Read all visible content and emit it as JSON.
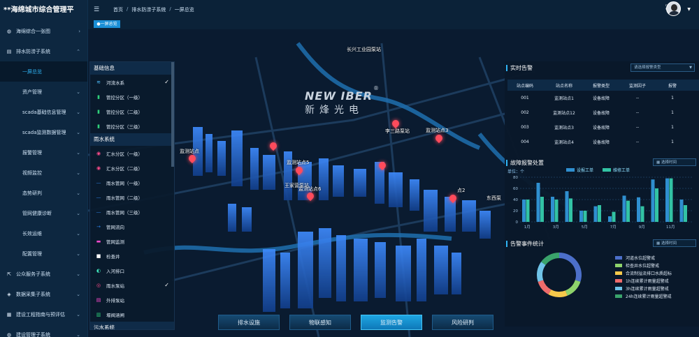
{
  "app": {
    "title": "**海绵城市综合管理平"
  },
  "sidebar": {
    "items": [
      {
        "label": "海绵综合一张图",
        "icon": "globe-icon",
        "chevron": "chevron-right-icon"
      },
      {
        "label": "排水防涝子系统",
        "icon": "drainage-icon",
        "chevron": "chevron-up-icon"
      },
      {
        "label": "一屏总览",
        "active": true
      },
      {
        "label": "资产管理",
        "chevron": "chevron-down-icon"
      },
      {
        "label": "scada基础信息管理",
        "chevron": "chevron-down-icon"
      },
      {
        "label": "scada监测数据管理",
        "chevron": "chevron-down-icon"
      },
      {
        "label": "报警管理",
        "chevron": "chevron-down-icon"
      },
      {
        "label": "视频监控",
        "chevron": "chevron-down-icon"
      },
      {
        "label": "态势研判",
        "chevron": "chevron-down-icon"
      },
      {
        "label": "管网健康诊断",
        "chevron": "chevron-down-icon"
      },
      {
        "label": "长效运维",
        "chevron": "chevron-down-icon"
      },
      {
        "label": "配置管理",
        "chevron": "chevron-down-icon"
      },
      {
        "label": "公众服务子系统",
        "icon": "external-link-icon",
        "chevron": "chevron-down-icon"
      },
      {
        "label": "数据采集子系统",
        "icon": "database-icon",
        "chevron": "chevron-down-icon"
      },
      {
        "label": "建设工程指南与预评估",
        "icon": "document-icon",
        "chevron": "chevron-down-icon"
      },
      {
        "label": "建设管理子系统",
        "icon": "globe-icon",
        "chevron": "chevron-down-icon"
      }
    ]
  },
  "topbar": {
    "breadcrumb": [
      "首页",
      "排水防涝子系统",
      "一屏总览"
    ],
    "separator": "/"
  },
  "tabs": [
    {
      "label": "●一屏总览"
    }
  ],
  "map": {
    "logo_main": "NEW IBER",
    "logo_reg": "®",
    "logo_cn": "新烽光电",
    "labels": [
      "长兴工业园泵站",
      "李三路泵站",
      "监测站点3",
      "监测站点",
      "监测站点5",
      "王家营泵站",
      "监测站点6",
      "点2",
      "东西泵"
    ]
  },
  "layer_panel": {
    "sections": [
      {
        "title": "基础信息",
        "rows": [
          {
            "label": "河流水系",
            "icon": "river-icon",
            "checked": true
          },
          {
            "label": "管控分区（一级）",
            "icon": "zone-icon",
            "checked": false
          },
          {
            "label": "管控分区（二级）",
            "icon": "zone-icon",
            "checked": false
          },
          {
            "label": "管控分区（三级）",
            "icon": "zone-icon",
            "checked": false
          }
        ]
      },
      {
        "title": "雨水系统",
        "rows": [
          {
            "label": "汇水分区（一级）",
            "icon": "catchment-icon",
            "checked": false
          },
          {
            "label": "汇水分区（二级）",
            "icon": "catchment-icon",
            "checked": false
          },
          {
            "label": "雨水管网（一级）",
            "icon": "pipe-icon",
            "checked": false
          },
          {
            "label": "雨水管网（二级）",
            "icon": "pipe-icon",
            "checked": false
          },
          {
            "label": "雨水管网（三级）",
            "icon": "pipe-icon",
            "checked": false
          },
          {
            "label": "管网流向",
            "icon": "flow-icon",
            "checked": false
          },
          {
            "label": "管网监测",
            "icon": "monitor-icon",
            "checked": false
          },
          {
            "label": "检查井",
            "icon": "manhole-icon",
            "checked": false
          },
          {
            "label": "入河排口",
            "icon": "outfall-icon",
            "checked": false
          },
          {
            "label": "雨水泵站",
            "icon": "pump-icon",
            "checked": true
          },
          {
            "label": "外排泵站",
            "icon": "pump-out-icon",
            "checked": false
          },
          {
            "label": "堰阀涵闸",
            "icon": "gate-icon",
            "checked": false
          }
        ]
      },
      {
        "title": "污水系统",
        "rows": []
      }
    ]
  },
  "bottom_tabs": [
    {
      "label": "排水设施",
      "active": false
    },
    {
      "label": "物联感知",
      "active": false
    },
    {
      "label": "监测告警",
      "active": true
    },
    {
      "label": "风险研判",
      "active": false
    }
  ],
  "realtime_alarm": {
    "title": "实时告警",
    "select_placeholder": "请选择报警类型",
    "columns": [
      "站点编码",
      "站点名称",
      "报警类型",
      "监测因子",
      "报警"
    ],
    "rows": [
      [
        "001",
        "监测站点1",
        "设备故障",
        "--",
        "1"
      ],
      [
        "002",
        "监测站点12",
        "设备故障",
        "--",
        "1"
      ],
      [
        "003",
        "监测站点3",
        "设备故障",
        "--",
        "1"
      ],
      [
        "004",
        "监测站点4",
        "设备故障",
        "--",
        "1"
      ]
    ]
  },
  "fault_alarm": {
    "title": "故障报警处置",
    "date_placeholder": "选择时间",
    "unit": "单位：个",
    "legend": [
      "设报工单",
      "维修工单"
    ]
  },
  "alarm_stats": {
    "title": "告警事件统计",
    "date_placeholder": "选择时间"
  },
  "chart_data": [
    {
      "type": "bar",
      "title": "故障报警处置",
      "ylabel": "单位：个",
      "categories": [
        "1月",
        "2月",
        "3月",
        "4月",
        "5月",
        "6月",
        "7月",
        "8月",
        "9月",
        "10月",
        "11月",
        "12月"
      ],
      "x_tick_labels": [
        "1月",
        "3月",
        "5月",
        "7月",
        "9月",
        "11月"
      ],
      "y_ticks": [
        0,
        20,
        40,
        60,
        80
      ],
      "ylim": [
        0,
        80
      ],
      "series": [
        {
          "name": "设报工单",
          "color": "#2f8fd0",
          "values": [
            40,
            70,
            45,
            55,
            20,
            28,
            10,
            47,
            44,
            76,
            78,
            40
          ]
        },
        {
          "name": "维修工单",
          "color": "#32c3a4",
          "values": [
            40,
            45,
            40,
            42,
            20,
            30,
            18,
            38,
            28,
            60,
            78,
            30
          ]
        }
      ]
    },
    {
      "type": "pie",
      "title": "告警事件统计",
      "categories": [
        "河道水位超警戒",
        "检查井水位超警戒",
        "合流制溢流排口水质超标",
        "1h连续累计雨量超警戒",
        "3h连续累计雨量超警戒",
        "24h连续累计雨量超警戒"
      ],
      "colors": [
        "#4c6fc9",
        "#8ed36b",
        "#f6c94b",
        "#ee6b6b",
        "#6fc3e8",
        "#3aa36b"
      ],
      "values": [
        30,
        14,
        14,
        12,
        15,
        15
      ]
    }
  ]
}
